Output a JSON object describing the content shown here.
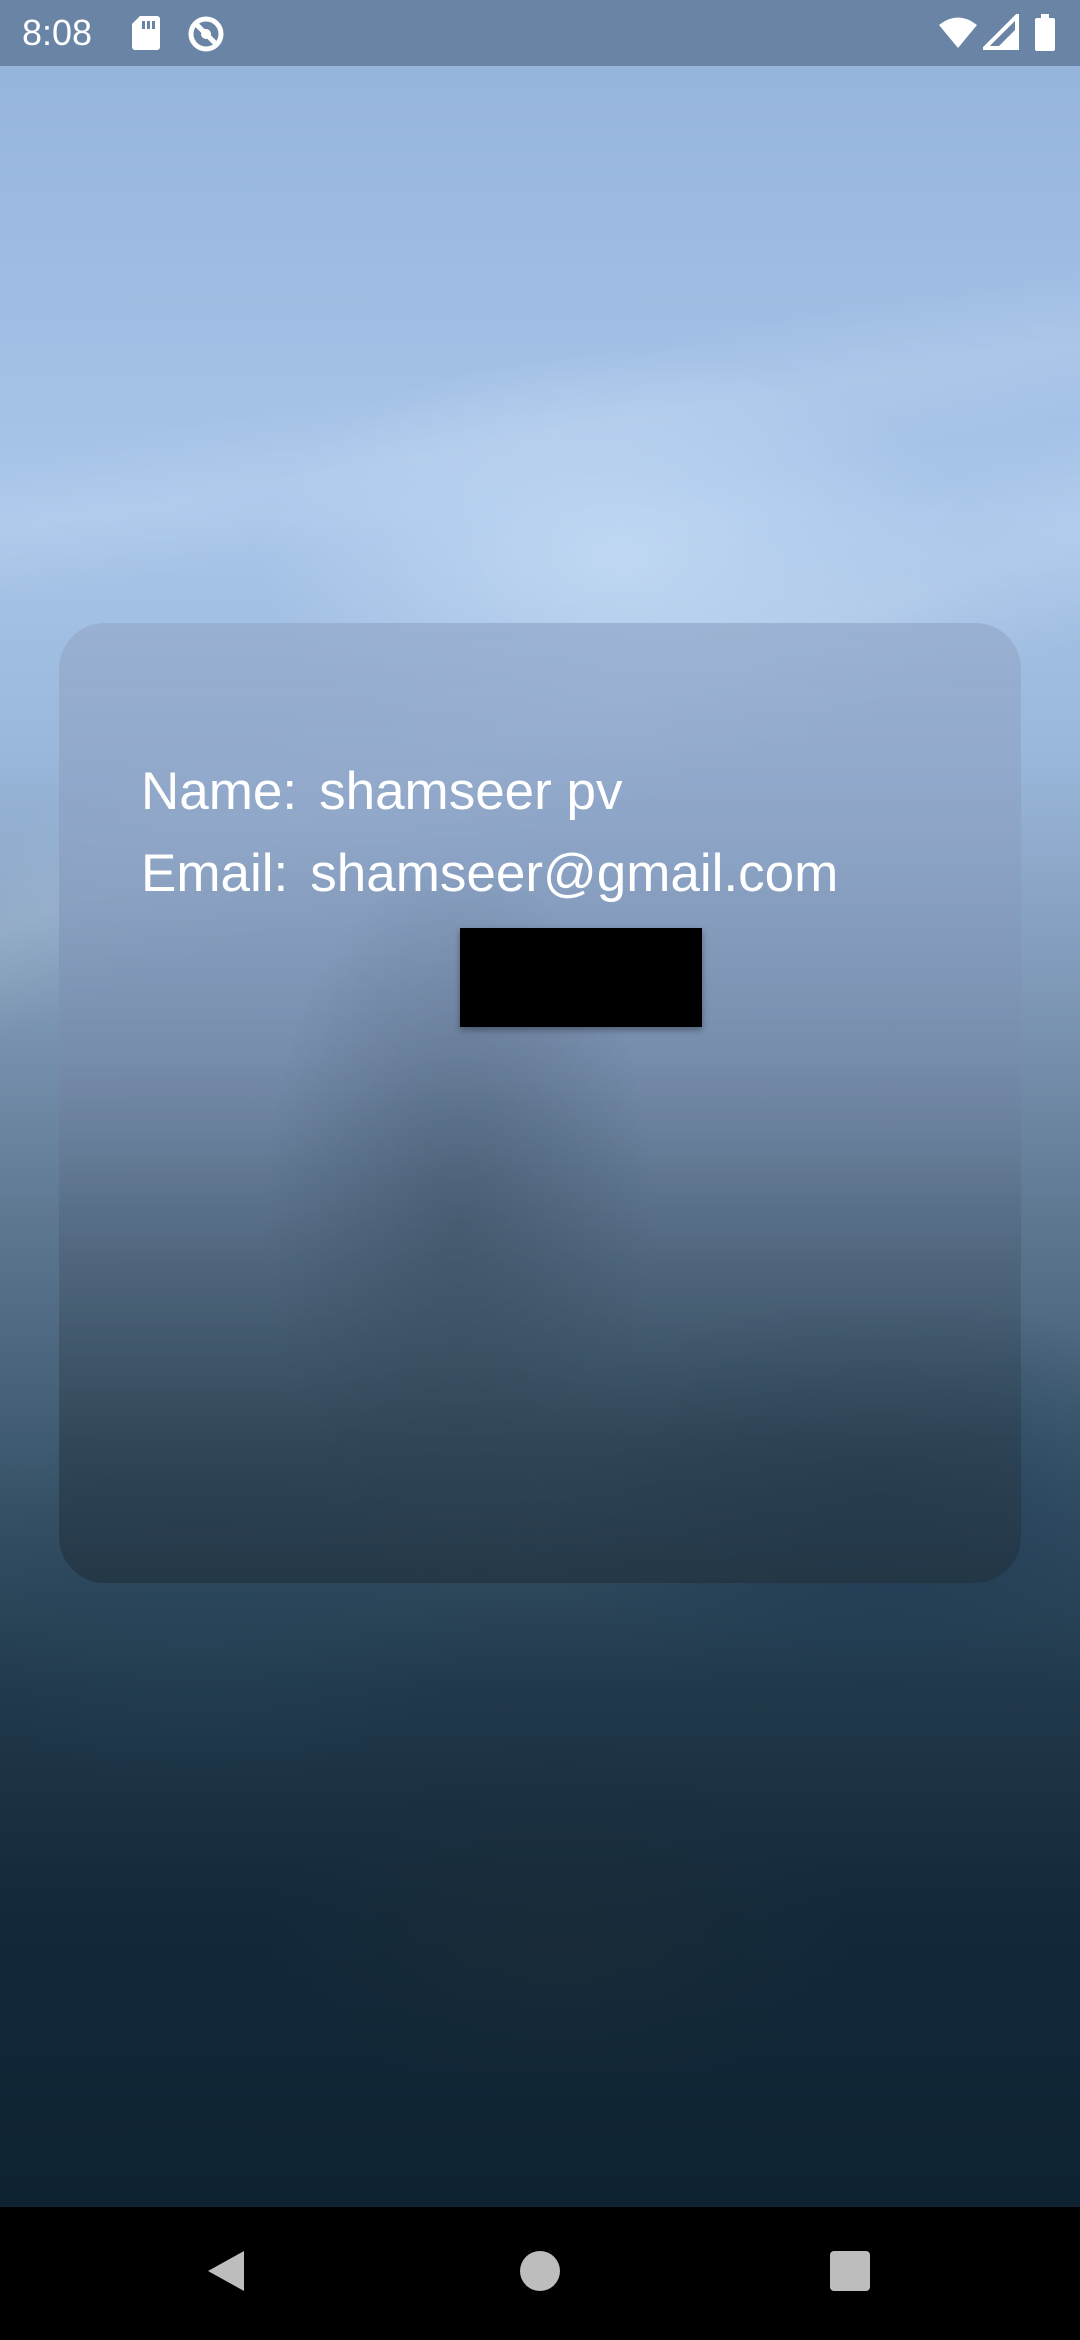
{
  "status_bar": {
    "time": "8:08",
    "left_icons": [
      "sd-card-icon",
      "data-saver-icon"
    ],
    "right_icons": [
      "wifi-icon",
      "cell-signal-icon",
      "battery-icon"
    ]
  },
  "card": {
    "name_label": "Name:",
    "name_value": "shamseer pv",
    "email_label": "Email:",
    "email_value": "shamseer@gmail.com",
    "button_color": "#000000"
  },
  "nav_bar": {
    "buttons": [
      "back-icon",
      "home-icon",
      "recents-icon"
    ]
  },
  "colors": {
    "status_bar_bg": "#6a84a6",
    "text": "#ffffff",
    "nav_bar_bg": "#000000"
  }
}
